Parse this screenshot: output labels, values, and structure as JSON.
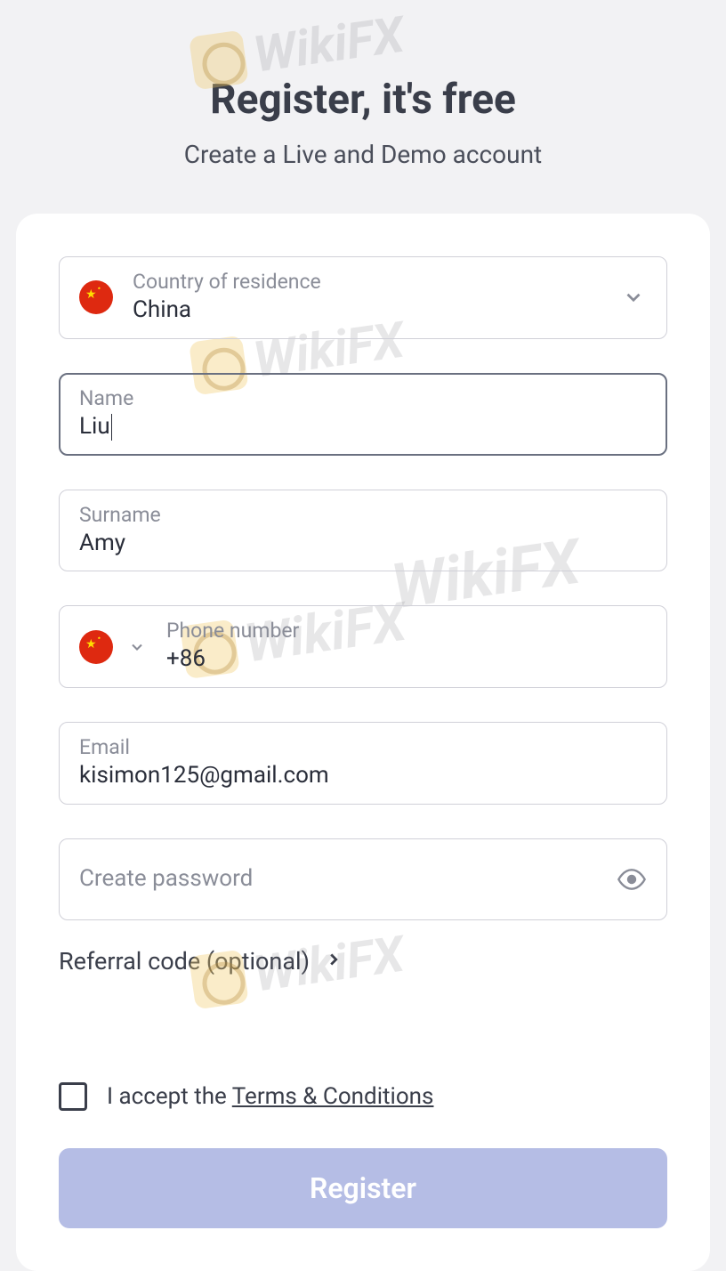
{
  "header": {
    "title": "Register, it's free",
    "subtitle": "Create a Live and Demo account"
  },
  "form": {
    "country": {
      "label": "Country of residence",
      "value": "China"
    },
    "name": {
      "label": "Name",
      "value": "Liu"
    },
    "surname": {
      "label": "Surname",
      "value": "Amy"
    },
    "phone": {
      "label": "Phone number",
      "code": "+86"
    },
    "email": {
      "label": "Email",
      "value": "kisimon125@gmail.com"
    },
    "password": {
      "label": "Create password"
    },
    "referral": {
      "label": "Referral code (optional)"
    },
    "terms": {
      "prefix": "I accept the ",
      "link": "Terms & Conditions"
    },
    "submit": "Register"
  },
  "watermark": "WikiFX"
}
